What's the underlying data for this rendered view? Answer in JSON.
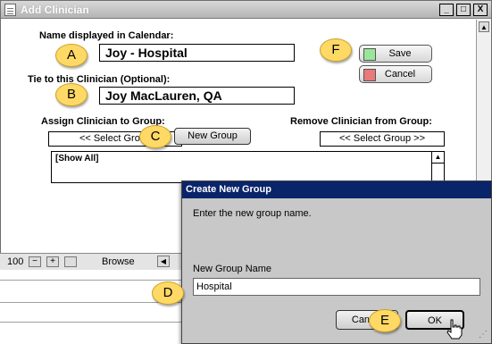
{
  "window": {
    "title": "Add Clinician",
    "minimize": "_",
    "maximize": "□",
    "close": "X"
  },
  "form": {
    "name_label": "Name displayed in Calendar:",
    "name_value": "Joy - Hospital",
    "tie_label": "Tie to this Clinician (Optional):",
    "tie_value": "Joy MacLauren, QA",
    "assign_label": "Assign Clinician to Group:",
    "remove_label": "Remove Clinician from Group:",
    "select_group_left": "<< Select Group",
    "select_group_right": "<< Select Group >>",
    "new_group": "New Group",
    "list_item": "[Show All]"
  },
  "buttons": {
    "save": "Save",
    "save_color": "#99e699",
    "cancel": "Cancel",
    "cancel_color": "#e87a7a"
  },
  "bottom": {
    "zoom": "100",
    "browse": "Browse"
  },
  "dialog": {
    "title": "Create New Group",
    "prompt": "Enter the new group name.",
    "field_label": "New Group Name",
    "field_value": "Hospital",
    "cancel": "Cancel",
    "ok": "OK"
  },
  "callouts": {
    "a": "A",
    "b": "B",
    "c": "C",
    "d": "D",
    "e": "E",
    "f": "F"
  },
  "icons": [
    "document-icon",
    "minus-icon",
    "plus-icon",
    "window-icon",
    "hand-pointer-icon"
  ]
}
